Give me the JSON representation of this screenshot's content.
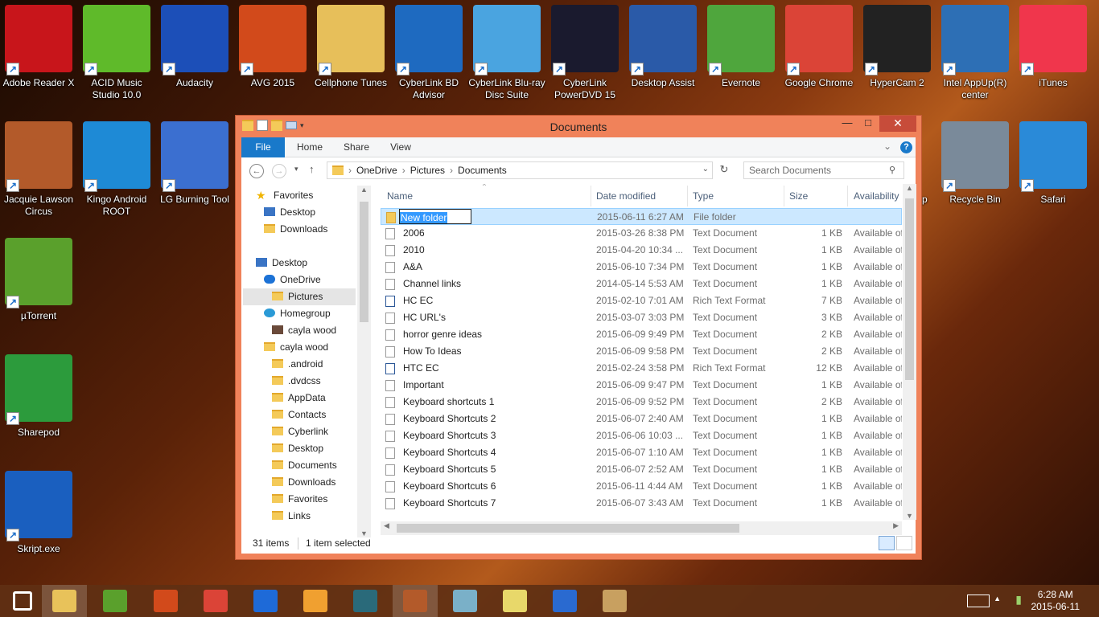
{
  "desktop": {
    "icons": [
      {
        "label": "Adobe Reader X",
        "icon": "adobe-reader-icon",
        "color": "#c8151b"
      },
      {
        "label": "ACID Music Studio 10.0",
        "icon": "acid-music-icon",
        "color": "#5fba2a"
      },
      {
        "label": "Audacity",
        "icon": "audacity-icon",
        "color": "#1c4fb8"
      },
      {
        "label": "AVG 2015",
        "icon": "avg-icon",
        "color": "#d24a1b"
      },
      {
        "label": "Cellphone Tunes",
        "icon": "folder-icon",
        "color": "#e7bf5a"
      },
      {
        "label": "CyberLink BD Advisor",
        "icon": "bd-advisor-icon",
        "color": "#1e6ac0"
      },
      {
        "label": "CyberLink Blu-ray Disc Suite",
        "icon": "bluray-suite-icon",
        "color": "#4aa4e0"
      },
      {
        "label": "CyberLink PowerDVD 15",
        "icon": "powerdvd-icon",
        "color": "#1a1a2e"
      },
      {
        "label": "Desktop Assist",
        "icon": "desktop-assist-icon",
        "color": "#2a5aa8"
      },
      {
        "label": "Evernote",
        "icon": "evernote-icon",
        "color": "#4fa63d"
      },
      {
        "label": "Google Chrome",
        "icon": "chrome-icon",
        "color": "#db4437"
      },
      {
        "label": "HyperCam 2",
        "icon": "hypercam-icon",
        "color": "#222222"
      },
      {
        "label": "Intel AppUp(R) center",
        "icon": "intel-appup-icon",
        "color": "#2d6fb5"
      },
      {
        "label": "iTunes",
        "icon": "itunes-icon",
        "color": "#f0364c"
      },
      {
        "label": "Jacquie Lawson Circus",
        "icon": "circus-icon",
        "color": "#b35a2a"
      },
      {
        "label": "Kingo Android ROOT",
        "icon": "kingo-root-icon",
        "color": "#1e8ad6"
      },
      {
        "label": "LG Burning Tool",
        "icon": "lg-burning-icon",
        "color": "#3b6fd0"
      },
      {
        "label": "µTorrent",
        "icon": "utorrent-icon",
        "color": "#5aa02c"
      },
      {
        "label": "Sharepod",
        "icon": "sharepod-icon",
        "color": "#2c9b3c"
      },
      {
        "label": "Skript.exe",
        "icon": "skript-icon",
        "color": "#1a5fbf"
      },
      {
        "label": "Recycle Bin",
        "icon": "recycle-bin-icon",
        "color": "#7a8a9a"
      },
      {
        "label": "Safari",
        "icon": "safari-icon",
        "color": "#2a8ad8"
      },
      {
        "label": "up",
        "icon": "partial-icon",
        "color": "#3a7a2a"
      }
    ]
  },
  "window": {
    "title": "Documents",
    "minimize": "—",
    "maximize": "□",
    "close": "✕",
    "ribbon": {
      "tabs": [
        "File",
        "Home",
        "Share",
        "View"
      ],
      "help": "?"
    },
    "address": {
      "crumbs": [
        "OneDrive",
        "Pictures",
        "Documents"
      ],
      "sep": "›"
    },
    "search_placeholder": "Search Documents",
    "nav": [
      {
        "label": "Favorites",
        "indent": 0,
        "kind": "star"
      },
      {
        "label": "Desktop",
        "indent": 1,
        "kind": "desk"
      },
      {
        "label": "Downloads",
        "indent": 1,
        "kind": "dl"
      },
      {
        "label": "Desktop",
        "indent": 0,
        "kind": "desk",
        "gap": true
      },
      {
        "label": "OneDrive",
        "indent": 1,
        "kind": "cloud"
      },
      {
        "label": "Pictures",
        "indent": 2,
        "kind": "folder",
        "selected": true
      },
      {
        "label": "Homegroup",
        "indent": 1,
        "kind": "home"
      },
      {
        "label": "cayla wood",
        "indent": 2,
        "kind": "user"
      },
      {
        "label": "cayla wood",
        "indent": 1,
        "kind": "folder"
      },
      {
        "label": ".android",
        "indent": 2,
        "kind": "folder"
      },
      {
        "label": ".dvdcss",
        "indent": 2,
        "kind": "folder"
      },
      {
        "label": "AppData",
        "indent": 2,
        "kind": "folder"
      },
      {
        "label": "Contacts",
        "indent": 2,
        "kind": "folder"
      },
      {
        "label": "Cyberlink",
        "indent": 2,
        "kind": "folder"
      },
      {
        "label": "Desktop",
        "indent": 2,
        "kind": "folder"
      },
      {
        "label": "Documents",
        "indent": 2,
        "kind": "folder"
      },
      {
        "label": "Downloads",
        "indent": 2,
        "kind": "folder"
      },
      {
        "label": "Favorites",
        "indent": 2,
        "kind": "folder"
      },
      {
        "label": "Links",
        "indent": 2,
        "kind": "folder"
      }
    ],
    "columns": {
      "name": "Name",
      "date": "Date modified",
      "type": "Type",
      "size": "Size",
      "avail": "Availability"
    },
    "files": [
      {
        "name": "New folder",
        "date": "2015-06-11 6:27 AM",
        "type": "File folder",
        "size": "",
        "avail": "",
        "kind": "folder",
        "editing": true
      },
      {
        "name": "2006",
        "date": "2015-03-26 8:38 PM",
        "type": "Text Document",
        "size": "1 KB",
        "avail": "Available of",
        "kind": "txt"
      },
      {
        "name": "2010",
        "date": "2015-04-20 10:34 ...",
        "type": "Text Document",
        "size": "1 KB",
        "avail": "Available of",
        "kind": "txt"
      },
      {
        "name": "A&A",
        "date": "2015-06-10 7:34 PM",
        "type": "Text Document",
        "size": "1 KB",
        "avail": "Available of",
        "kind": "txt"
      },
      {
        "name": "Channel links",
        "date": "2014-05-14 5:53 AM",
        "type": "Text Document",
        "size": "1 KB",
        "avail": "Available of",
        "kind": "txt"
      },
      {
        "name": "HC EC",
        "date": "2015-02-10 7:01 AM",
        "type": "Rich Text Format",
        "size": "7 KB",
        "avail": "Available of",
        "kind": "rtf"
      },
      {
        "name": "HC URL's",
        "date": "2015-03-07 3:03 PM",
        "type": "Text Document",
        "size": "3 KB",
        "avail": "Available of",
        "kind": "txt"
      },
      {
        "name": "horror genre ideas",
        "date": "2015-06-09 9:49 PM",
        "type": "Text Document",
        "size": "2 KB",
        "avail": "Available of",
        "kind": "txt"
      },
      {
        "name": "How To Ideas",
        "date": "2015-06-09 9:58 PM",
        "type": "Text Document",
        "size": "2 KB",
        "avail": "Available of",
        "kind": "txt"
      },
      {
        "name": "HTC EC",
        "date": "2015-02-24 3:58 PM",
        "type": "Rich Text Format",
        "size": "12 KB",
        "avail": "Available of",
        "kind": "rtf"
      },
      {
        "name": "Important",
        "date": "2015-06-09 9:47 PM",
        "type": "Text Document",
        "size": "1 KB",
        "avail": "Available of",
        "kind": "txt"
      },
      {
        "name": "Keyboard shortcuts 1",
        "date": "2015-06-09 9:52 PM",
        "type": "Text Document",
        "size": "2 KB",
        "avail": "Available of",
        "kind": "txt"
      },
      {
        "name": "Keyboard Shortcuts 2",
        "date": "2015-06-07 2:40 AM",
        "type": "Text Document",
        "size": "1 KB",
        "avail": "Available of",
        "kind": "txt"
      },
      {
        "name": "Keyboard Shortcuts 3",
        "date": "2015-06-06 10:03 ...",
        "type": "Text Document",
        "size": "1 KB",
        "avail": "Available of",
        "kind": "txt"
      },
      {
        "name": "Keyboard Shortcuts 4",
        "date": "2015-06-07 1:10 AM",
        "type": "Text Document",
        "size": "1 KB",
        "avail": "Available of",
        "kind": "txt"
      },
      {
        "name": "Keyboard Shortcuts 5",
        "date": "2015-06-07 2:52 AM",
        "type": "Text Document",
        "size": "1 KB",
        "avail": "Available of",
        "kind": "txt"
      },
      {
        "name": "Keyboard Shortcuts 6",
        "date": "2015-06-11 4:44 AM",
        "type": "Text Document",
        "size": "1 KB",
        "avail": "Available of",
        "kind": "txt"
      },
      {
        "name": "Keyboard Shortcuts 7",
        "date": "2015-06-07 3:43 AM",
        "type": "Text Document",
        "size": "1 KB",
        "avail": "Available of",
        "kind": "txt"
      }
    ],
    "status": {
      "count": "31 items",
      "selected": "1 item selected"
    }
  },
  "taskbar": {
    "apps": [
      {
        "icon": "start-icon",
        "color": "#ffffff"
      },
      {
        "icon": "file-explorer-icon",
        "color": "#e8c25a"
      },
      {
        "icon": "wondershare-icon",
        "color": "#5aa02c"
      },
      {
        "icon": "avg-icon",
        "color": "#d24a1b"
      },
      {
        "icon": "chrome-icon",
        "color": "#db4437"
      },
      {
        "icon": "malwarebytes-icon",
        "color": "#1e6ad8"
      },
      {
        "icon": "video-player-icon",
        "color": "#f0a030"
      },
      {
        "icon": "film-icon",
        "color": "#2a6a7a"
      },
      {
        "icon": "circus-icon",
        "color": "#b35a2a"
      },
      {
        "icon": "note-icon",
        "color": "#7ab0c8"
      },
      {
        "icon": "sticky-notes-icon",
        "color": "#e8d86a"
      },
      {
        "icon": "wordpad-icon",
        "color": "#2a6ad0"
      },
      {
        "icon": "paint-icon",
        "color": "#c8a060"
      }
    ],
    "time": "6:28 AM",
    "date": "2015-06-11"
  }
}
